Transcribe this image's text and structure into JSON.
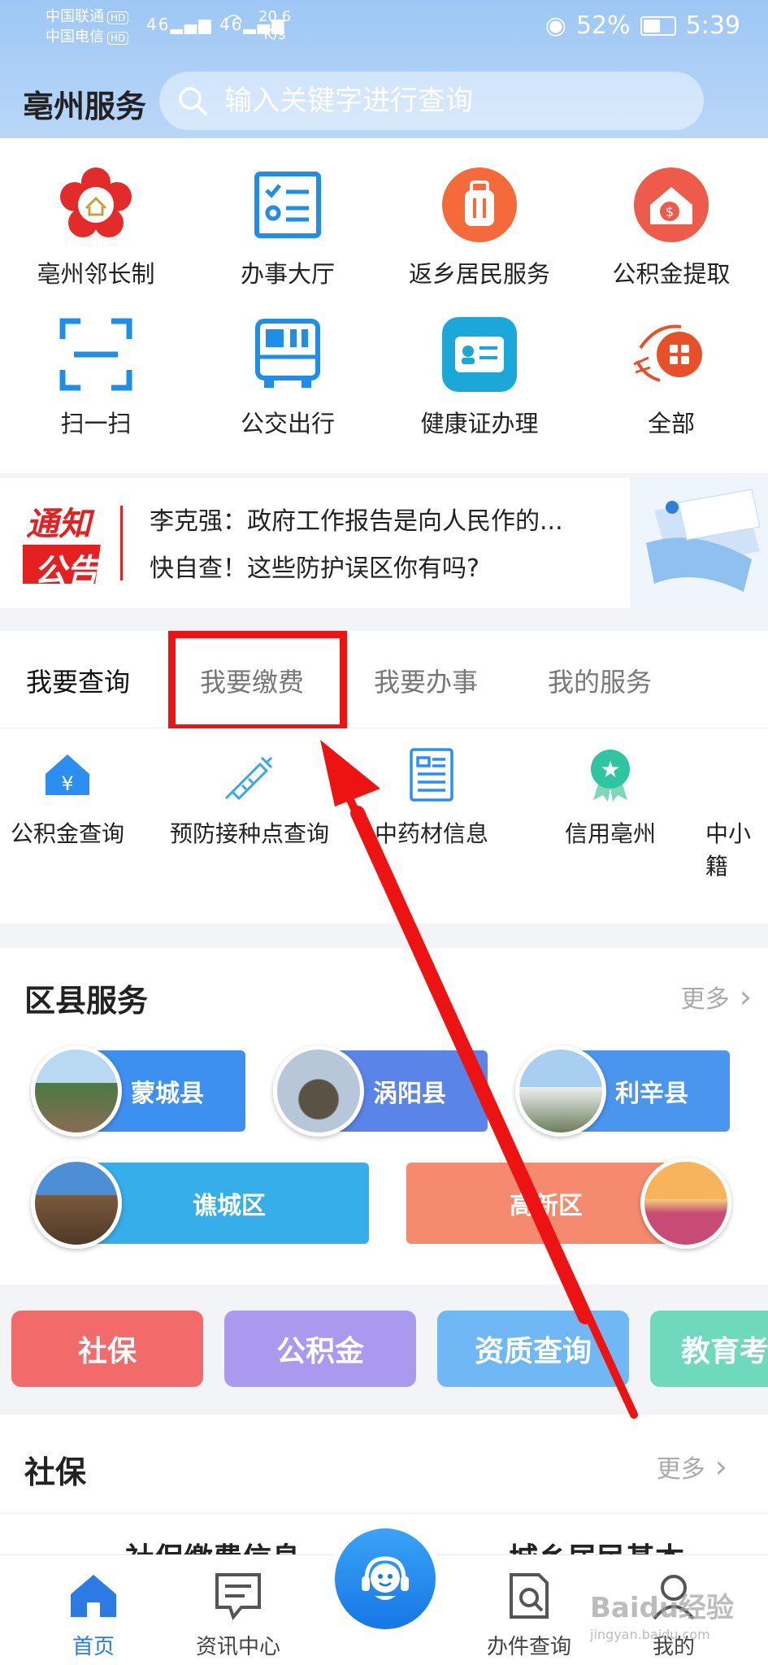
{
  "status": {
    "carrier1": "中国联通",
    "carrier2": "中国电信",
    "hd": "HD",
    "sig1": "46",
    "sig2": "46",
    "speed_value": "20.6",
    "speed_unit": "K/s",
    "battery": "52%",
    "time": "5:39"
  },
  "header": {
    "title": "亳州服务",
    "search_placeholder": "输入关键字进行查询"
  },
  "grid": [
    {
      "label": "亳州邻长制",
      "icon": "flower-logo-icon"
    },
    {
      "label": "办事大厅",
      "icon": "checklist-icon"
    },
    {
      "label": "返乡居民服务",
      "icon": "luggage-icon"
    },
    {
      "label": "公积金提取",
      "icon": "house-coin-icon"
    },
    {
      "label": "扫一扫",
      "icon": "scan-icon"
    },
    {
      "label": "公交出行",
      "icon": "bus-icon"
    },
    {
      "label": "健康证办理",
      "icon": "id-card-icon"
    },
    {
      "label": "全部",
      "icon": "all-apps-icon"
    }
  ],
  "notice": {
    "logo_line1": "通知",
    "logo_line2": "公告",
    "line1": "李克强：政府工作报告是向人民作的...",
    "line2": "快自查！这些防护误区你有吗?"
  },
  "tabs": [
    {
      "label": "我要查询",
      "active": true
    },
    {
      "label": "我要缴费",
      "active": false
    },
    {
      "label": "我要办事",
      "active": false
    },
    {
      "label": "我的服务",
      "active": false
    }
  ],
  "tab_items": [
    {
      "label": "公积金查询",
      "icon": "house-yen-icon"
    },
    {
      "label": "预防接种点查询",
      "icon": "syringe-icon"
    },
    {
      "label": "中药材信息",
      "icon": "document-list-icon"
    },
    {
      "label": "信用亳州",
      "icon": "badge-star-icon"
    },
    {
      "label": "中小籍",
      "icon": "none"
    }
  ],
  "county": {
    "title": "区县服务",
    "more": "更多",
    "items": [
      "蒙城县",
      "涡阳县",
      "利辛县",
      "谯城区",
      "高新区"
    ]
  },
  "categories": [
    {
      "label": "社保",
      "color": "#f26a6a"
    },
    {
      "label": "公积金",
      "color": "#a99af0"
    },
    {
      "label": "资质查询",
      "color": "#6fb8f5"
    },
    {
      "label": "教育考",
      "color": "#6fd9be"
    }
  ],
  "shebao": {
    "title": "社保",
    "more": "更多",
    "item1": "社保缴费信息",
    "item2": "城乡居民基本"
  },
  "nav": [
    {
      "label": "首页",
      "icon": "home-icon",
      "active": true
    },
    {
      "label": "资讯中心",
      "icon": "message-icon",
      "active": false
    },
    {
      "label": "办件查询",
      "icon": "doc-search-icon",
      "active": false
    },
    {
      "label": "我的",
      "icon": "person-icon",
      "active": false
    }
  ],
  "watermark": {
    "text": "Baidu经验",
    "sub": "jingyan.baidu.com"
  },
  "colors": {
    "accent": "#2c7be5",
    "highlight": "#ee1313"
  }
}
